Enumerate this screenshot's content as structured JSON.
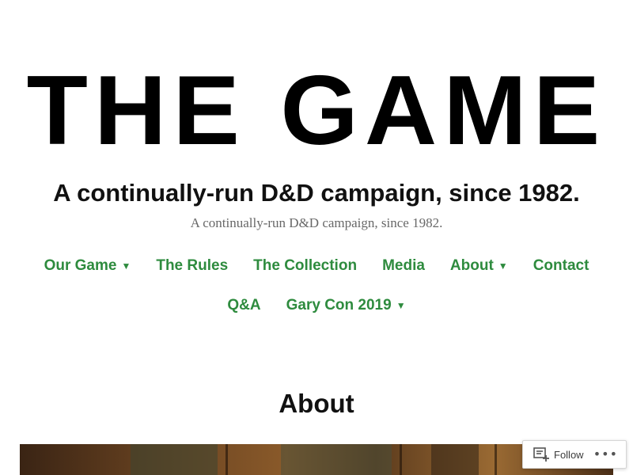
{
  "header": {
    "logo_text": "THE GAME",
    "site_title": "A continually-run D&D campaign, since 1982.",
    "tagline": "A continually-run D&D campaign, since 1982."
  },
  "nav": {
    "items": [
      {
        "label": "Our Game",
        "has_submenu": true
      },
      {
        "label": "The Rules",
        "has_submenu": false
      },
      {
        "label": "The Collection",
        "has_submenu": false
      },
      {
        "label": "Media",
        "has_submenu": false
      },
      {
        "label": "About",
        "has_submenu": true
      },
      {
        "label": "Contact",
        "has_submenu": false
      },
      {
        "label": "Q&A",
        "has_submenu": false
      },
      {
        "label": "Gary Con 2019",
        "has_submenu": true
      }
    ],
    "submenu_glyph": "▼",
    "link_color": "#2e8b3e"
  },
  "main": {
    "page_title": "About",
    "featured_image_icon": "wood-interior-photo"
  },
  "follow_widget": {
    "follow_label": "Follow",
    "follow_icon": "reader-follow-icon",
    "more_label": "•••",
    "more_icon": "more-ellipsis-icon"
  }
}
